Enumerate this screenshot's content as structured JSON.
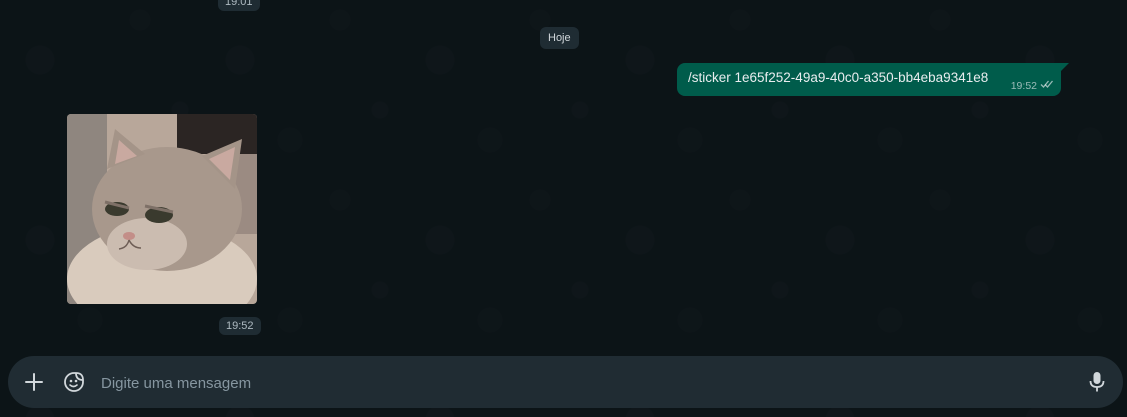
{
  "conversation": {
    "previous_time": "19:01",
    "date_separator": "Hoje"
  },
  "outgoing_message": {
    "text": "/sticker 1e65f252-49a9-40c0-a350-bb4eba9341e8",
    "time": "19:52",
    "status_icon": "double-check-icon"
  },
  "incoming_sticker": {
    "alt": "cat sticker",
    "time": "19:52"
  },
  "composer": {
    "placeholder": "Digite uma mensagem",
    "attach_icon": "plus-icon",
    "sticker_icon": "sticker-icon",
    "mic_icon": "microphone-icon"
  },
  "colors": {
    "outgoing_bubble": "#005c4b",
    "chat_background": "#111b21",
    "composer_background": "#202c33"
  }
}
